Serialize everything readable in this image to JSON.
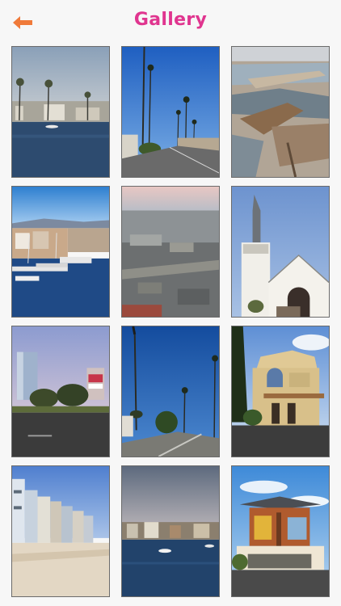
{
  "header": {
    "title": "Gallery",
    "back_icon": "back-arrow-icon",
    "title_color": "#e0358f",
    "back_color": "#f07a3a"
  },
  "gallery": {
    "photos": [
      {
        "subject": "marina-palm-waterfront"
      },
      {
        "subject": "palm-lined-street"
      },
      {
        "subject": "wetlands-aerial"
      },
      {
        "subject": "harbor-boats"
      },
      {
        "subject": "city-aerial"
      },
      {
        "subject": "white-church-steeple"
      },
      {
        "subject": "office-tower-dusk"
      },
      {
        "subject": "palm-street-sidewalk"
      },
      {
        "subject": "domed-building"
      },
      {
        "subject": "beach-houses"
      },
      {
        "subject": "bay-waterfront"
      },
      {
        "subject": "modern-building"
      }
    ]
  }
}
